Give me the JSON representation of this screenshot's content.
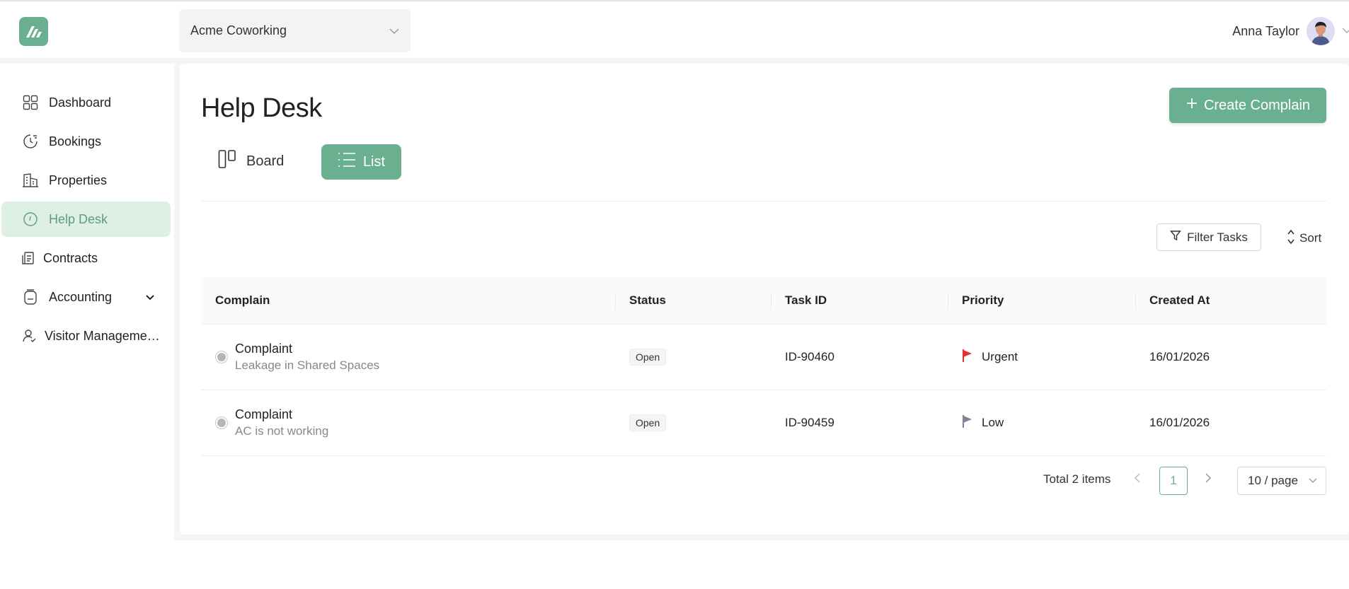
{
  "header": {
    "workspace": "Acme Coworking",
    "user_name": "Anna Taylor"
  },
  "sidebar": {
    "items": [
      {
        "label": "Dashboard",
        "icon": "grid-icon"
      },
      {
        "label": "Bookings",
        "icon": "clock-icon"
      },
      {
        "label": "Properties",
        "icon": "buildings-icon"
      },
      {
        "label": "Help Desk",
        "icon": "help-clock-icon",
        "active": true
      },
      {
        "label": "Contracts",
        "icon": "contract-icon"
      },
      {
        "label": "Accounting",
        "icon": "jar-icon",
        "expandable": true
      },
      {
        "label": "Visitor Manageme…",
        "icon": "visitor-icon"
      }
    ]
  },
  "main": {
    "title": "Help Desk",
    "create_label": "Create Complain",
    "views": {
      "board": "Board",
      "list": "List"
    },
    "filter_label": "Filter Tasks",
    "sort_label": "Sort"
  },
  "table": {
    "columns": [
      "Complain",
      "Status",
      "Task ID",
      "Priority",
      "Created At"
    ],
    "rows": [
      {
        "title": "Complaint",
        "subtitle": "Leakage in Shared Spaces",
        "status": "Open",
        "task_id": "ID-90460",
        "priority": "Urgent",
        "priority_color": "#e03131",
        "created": "16/01/2026"
      },
      {
        "title": "Complaint",
        "subtitle": "AC is not working",
        "status": "Open",
        "task_id": "ID-90459",
        "priority": "Low",
        "priority_color": "#7d8593",
        "created": "16/01/2026"
      }
    ]
  },
  "pagination": {
    "total": "Total 2 items",
    "current_page": "1",
    "page_size": "10 / page"
  },
  "colors": {
    "accent": "#6aaf8f",
    "active_bg": "#deefe5"
  }
}
